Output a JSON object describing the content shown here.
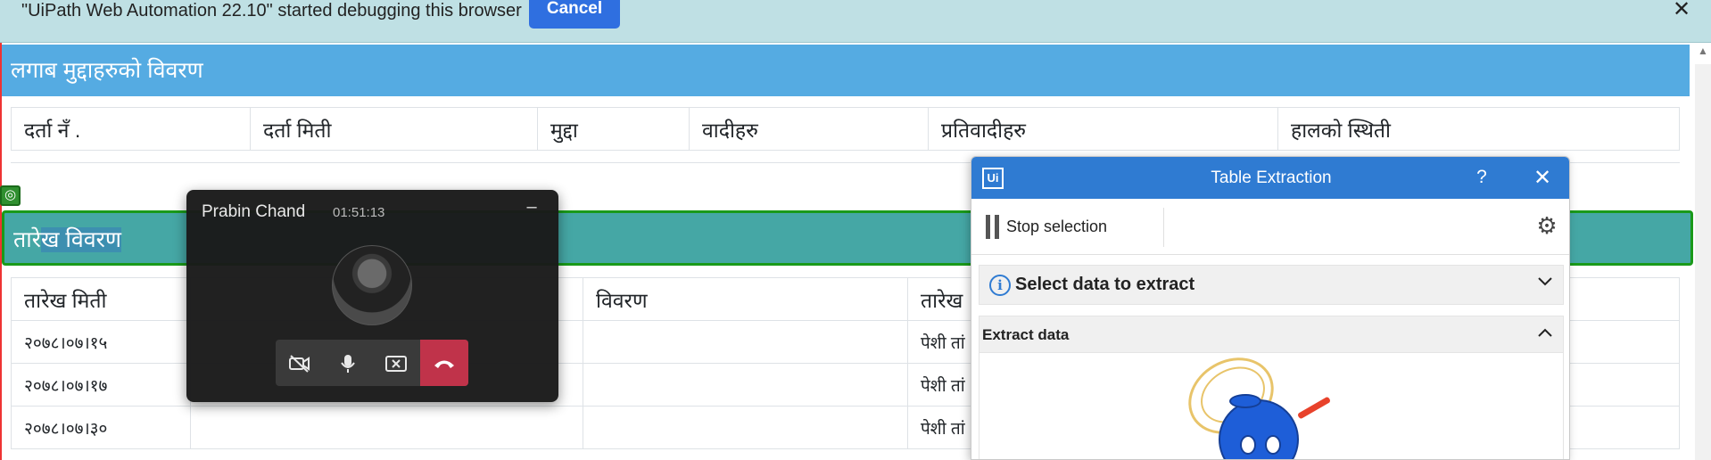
{
  "infobar": {
    "message": "\"UiPath Web Automation 22.10\" started debugging this browser",
    "cancel_label": "Cancel",
    "close_glyph": "✕"
  },
  "page": {
    "section1_title": "लगाब मुद्दाहरुको विवरण",
    "table1_headers": [
      "दर्ता नँ .",
      "दर्ता मिती",
      "मुद्दा",
      "वादीहरु",
      "प्रतिवादीहरु",
      "हालको स्थिती"
    ],
    "section2_title_part1": "तारे",
    "section2_title_part2": "ख विवरण",
    "table2_headers": [
      "तारेख मिती",
      "",
      "विवरण",
      "तारेख",
      ""
    ],
    "table2_rows": [
      [
        "२०७८।०७।१५",
        "",
        "",
        "पेशी तां",
        ""
      ],
      [
        "२०७८।०७।१७",
        "",
        "",
        "पेशी तां",
        ""
      ],
      [
        "२०७८।०७।३०",
        "",
        "",
        "पेशी तां",
        ""
      ]
    ]
  },
  "call": {
    "name": "Prabin Chand",
    "duration": "01:51:13",
    "minimize_glyph": "–"
  },
  "table_extraction": {
    "logo": "Ui",
    "title": "Table Extraction",
    "help_glyph": "?",
    "close_glyph": "✕",
    "stop_label": "Stop selection",
    "select_section_label": "Select data to extract",
    "extract_section_label": "Extract data"
  },
  "icons": {
    "video_off": "video-off-icon",
    "mic": "mic-icon",
    "share_stop": "stop-share-icon",
    "hangup": "hangup-icon",
    "gear": "gear-icon",
    "info": "info-icon"
  },
  "colors": {
    "infobar_bg": "#bfe0e4",
    "cancel_bg": "#2f6fe0",
    "section_header": "#55abe2",
    "selected_header": "#45a7a5",
    "selection_border": "#1a9a1a",
    "te_titlebar": "#2f7bd2",
    "hangup": "#c0334a"
  }
}
